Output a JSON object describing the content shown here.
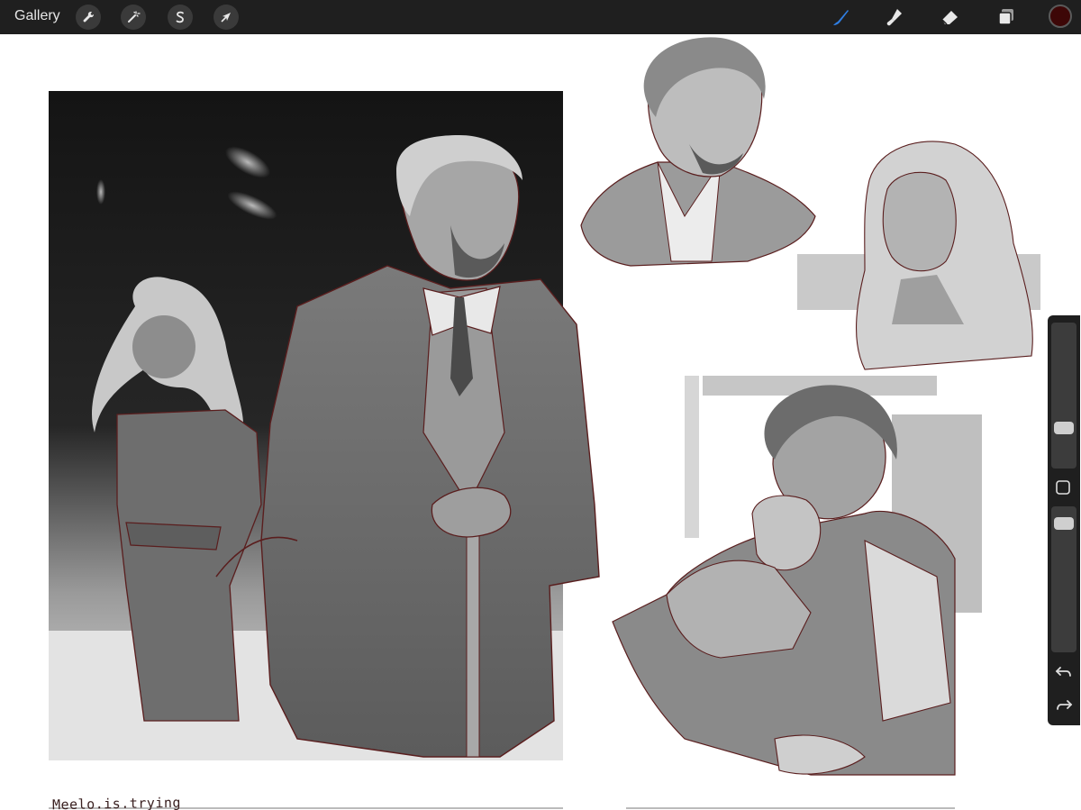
{
  "app": {
    "gallery_label": "Gallery",
    "left_tools": [
      {
        "name": "actions",
        "icon": "wrench-icon"
      },
      {
        "name": "adjustments",
        "icon": "magic-wand-icon"
      },
      {
        "name": "selection",
        "icon": "selection-s-icon"
      },
      {
        "name": "transform",
        "icon": "arrow-cursor-icon"
      }
    ],
    "right_tools": [
      {
        "name": "brush",
        "icon": "brush-icon",
        "active": true,
        "color": "#2f7de1"
      },
      {
        "name": "smudge",
        "icon": "smudge-icon"
      },
      {
        "name": "eraser",
        "icon": "eraser-icon"
      },
      {
        "name": "layers",
        "icon": "layers-icon"
      }
    ],
    "current_color": "#3d0707"
  },
  "canvas": {
    "signature": "Meelo.is.trying",
    "artwork": "grayscale character sketches with dark red line art",
    "line_color": "#5a1e1e"
  },
  "sidebar": {
    "brush_size_level": 0.35,
    "opacity_level": 0.6,
    "modify_icon": "square-modify-icon",
    "undo_icon": "undo-icon",
    "redo_icon": "redo-icon"
  }
}
